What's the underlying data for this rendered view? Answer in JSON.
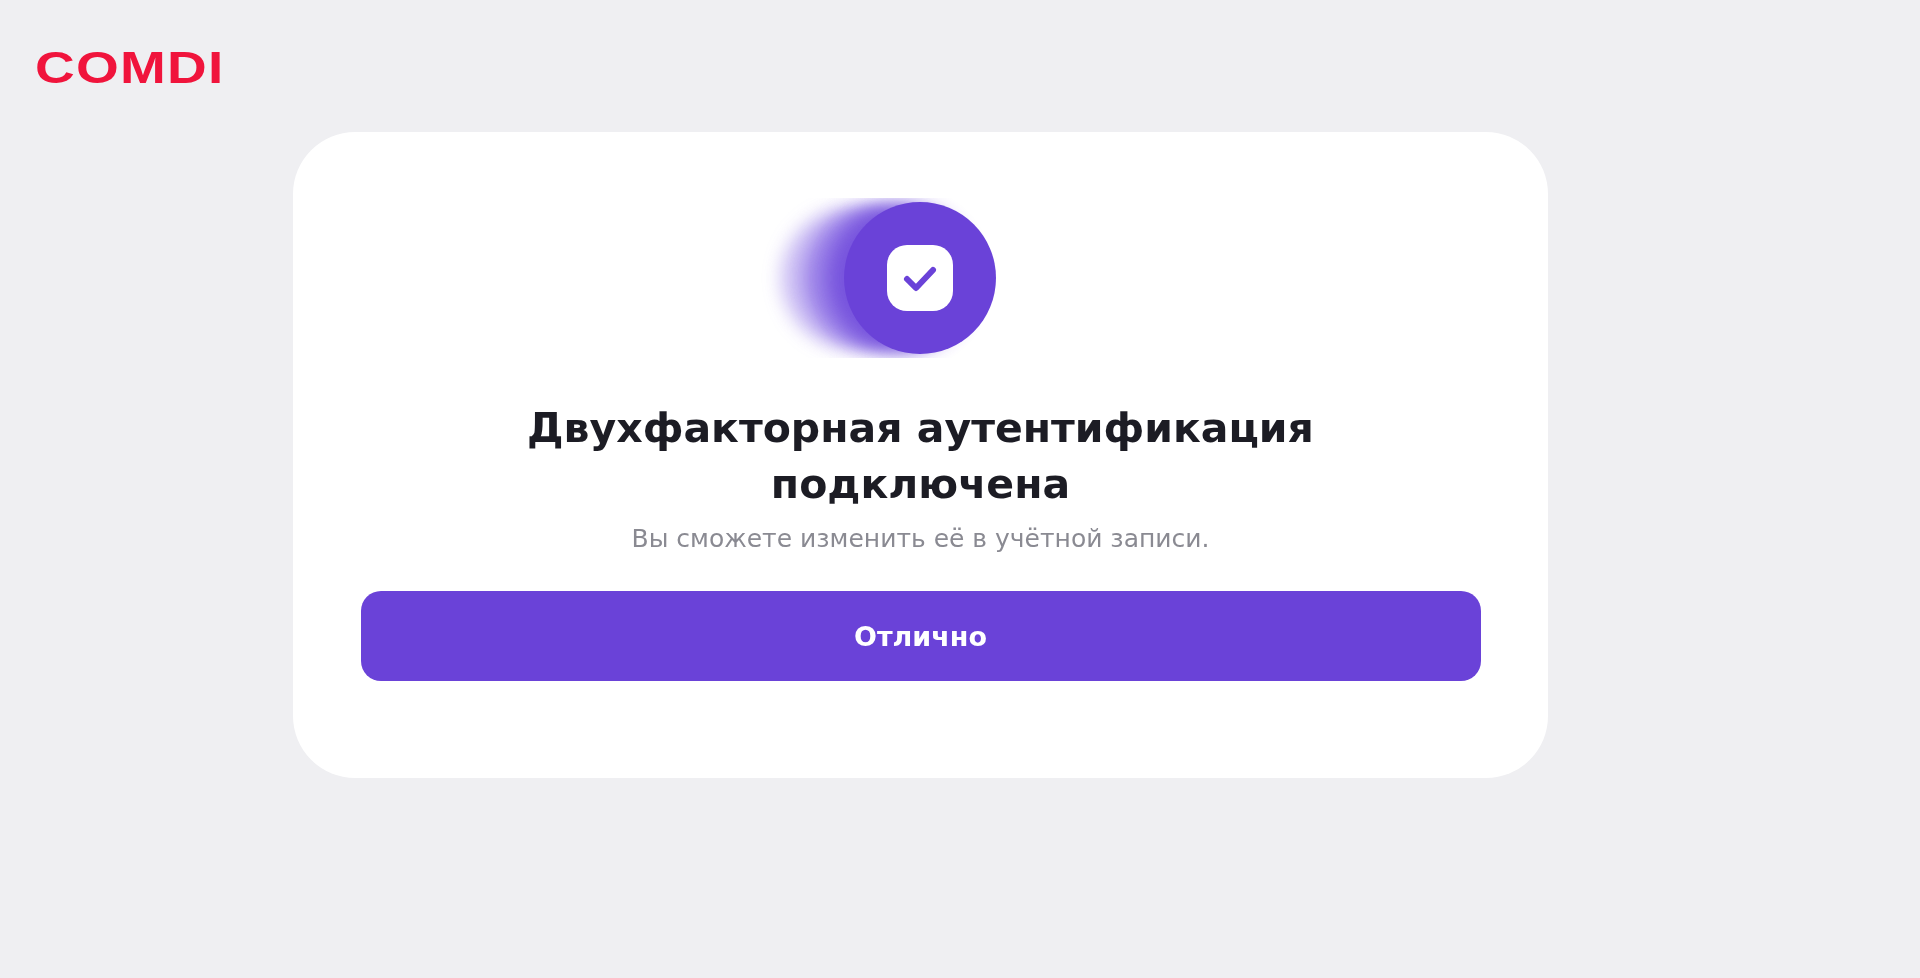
{
  "logo": "COMDI",
  "dialog": {
    "title": "Двухфакторная аутентификация подключена",
    "message": "Вы сможете изменить её в учётной записи.",
    "button": "Отлично"
  }
}
